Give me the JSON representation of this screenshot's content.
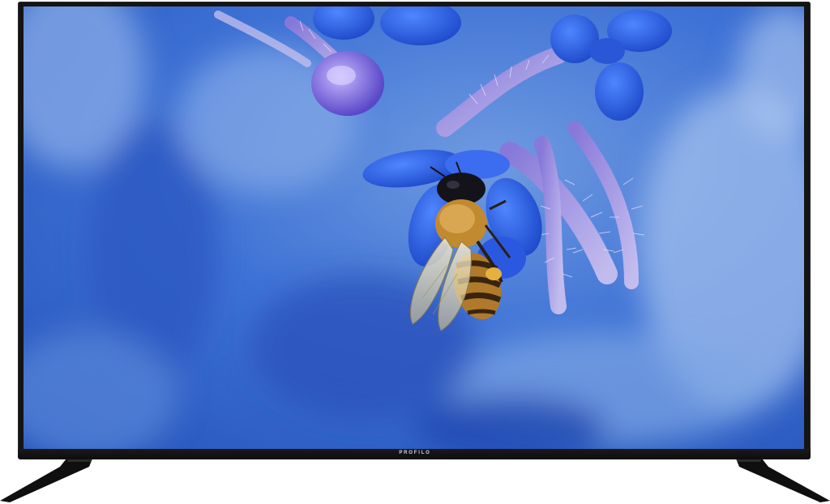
{
  "tv": {
    "brand": "PROFILO"
  },
  "screen": {
    "subject": "bee-on-blue-flower",
    "colors": {
      "background_dark": "#1c4fb8",
      "background_light": "#8fb4e6",
      "petal": "#2f5fe0",
      "bee_body": "#c88a2c",
      "bee_stripe": "#3a2410"
    }
  },
  "colors": {
    "bezel": "#141414",
    "stand": "#0f0f0f"
  }
}
